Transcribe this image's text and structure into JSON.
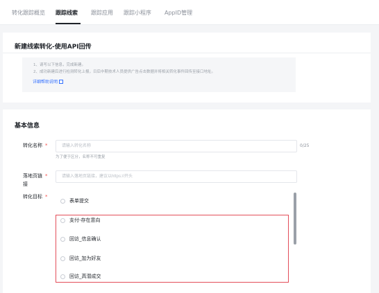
{
  "tabs": [
    "转化跟踪概览",
    "跟踪线索",
    "跟踪应用",
    "跟踪小程序",
    "AppID管理"
  ],
  "card1": {
    "title": "新建线索转化-使用API回传",
    "notice": {
      "line1": "1、请写以下信息，完成新建。",
      "line2": "2、成功新建后进行检测转化上报，日后中期技术人员提供广告点击数据并将相关转化事件回传至接口地址。",
      "link": "详细帮助说明"
    }
  },
  "card2": {
    "title": "基本信息",
    "name_field": {
      "label": "转化名称",
      "required": "*",
      "placeholder": "请输入转化名称",
      "counter": "0/25",
      "hint": "为了便于区分，名称不可重复"
    },
    "url_field": {
      "label_line1": "落地页链",
      "label_line2": "接",
      "required": "*",
      "placeholder": "请输入落地页链接，建议以https://开头"
    },
    "goal_field": {
      "label": "转化目标",
      "required": "*",
      "options": [
        "表单提交",
        "支付-存在意向",
        "回访_信息确认",
        "回访_加为好友",
        "回访_高潜成交"
      ]
    }
  },
  "colors": {
    "accent": "#3370ff",
    "required": "#f54a45",
    "highlight_border": "#e34d59"
  }
}
